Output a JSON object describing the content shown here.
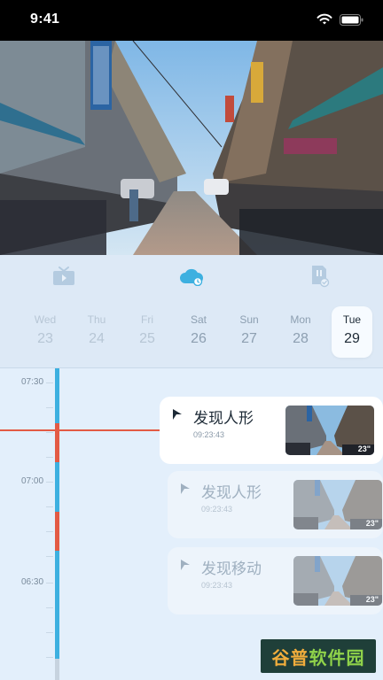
{
  "status_bar": {
    "time": "9:41"
  },
  "tabs": [
    {
      "icon": "tv-icon",
      "active": false
    },
    {
      "icon": "cloud-icon",
      "active": true
    },
    {
      "icon": "sd-card-icon",
      "active": false
    }
  ],
  "dates": [
    {
      "weekday": "Wed",
      "day": "23"
    },
    {
      "weekday": "Thu",
      "day": "24"
    },
    {
      "weekday": "Fri",
      "day": "25"
    },
    {
      "weekday": "Sat",
      "day": "26"
    },
    {
      "weekday": "Sun",
      "day": "27"
    },
    {
      "weekday": "Mon",
      "day": "28"
    },
    {
      "weekday": "Tue",
      "day": "29",
      "selected": true
    }
  ],
  "timeline": {
    "labels": [
      "07:30",
      "07:00",
      "06:30"
    ]
  },
  "events": [
    {
      "title": "发现人形",
      "time": "09:23:43",
      "duration": "23\""
    },
    {
      "title": "发现人形",
      "time": "09:23:43",
      "duration": "23\""
    },
    {
      "title": "发现移动",
      "time": "09:23:43",
      "duration": "23\""
    }
  ],
  "watermark": {
    "part1": "谷普",
    "part2": "软件园"
  },
  "colors": {
    "accent_blue": "#3db0e0",
    "marker_red": "#e35a44"
  }
}
